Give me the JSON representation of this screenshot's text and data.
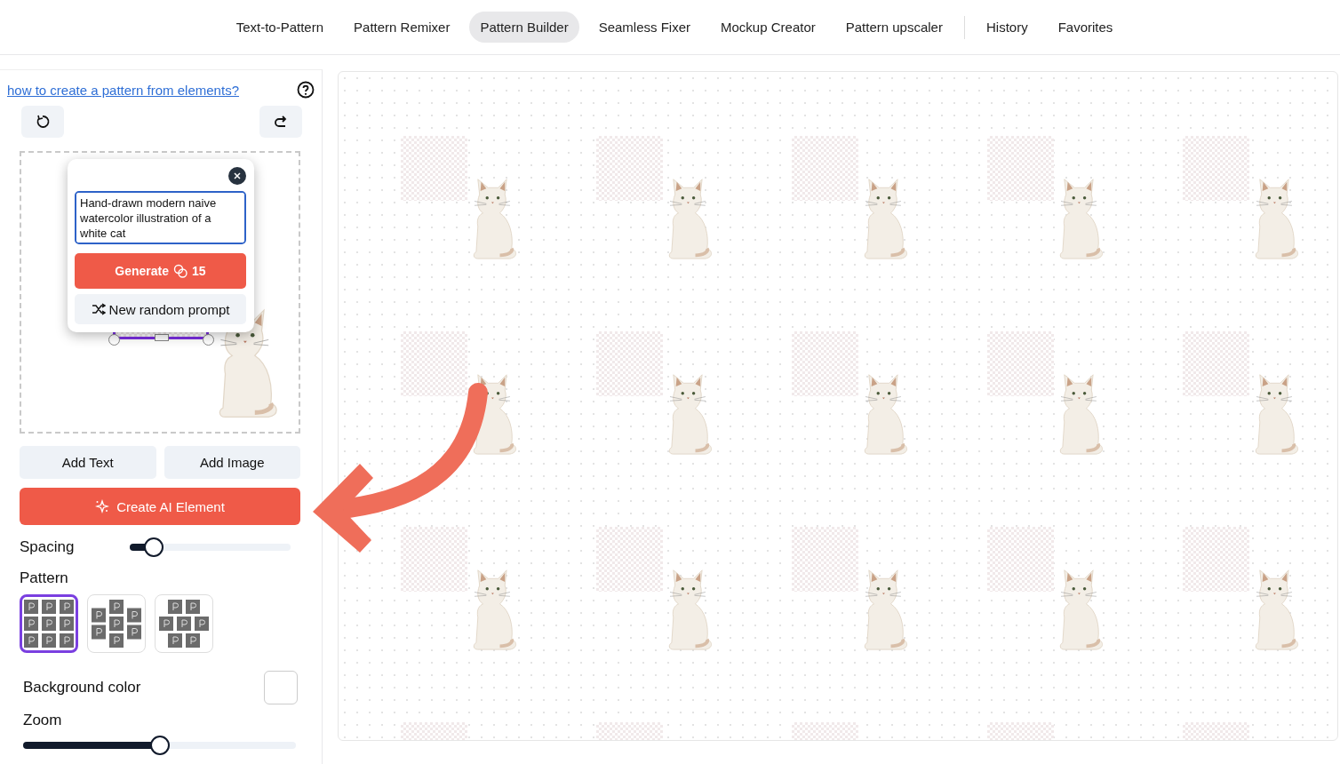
{
  "nav": {
    "tools": [
      {
        "label": "Text-to-Pattern",
        "selected": false
      },
      {
        "label": "Pattern Remixer",
        "selected": false
      },
      {
        "label": "Pattern Builder",
        "selected": true
      },
      {
        "label": "Seamless Fixer",
        "selected": false
      },
      {
        "label": "Mockup Creator",
        "selected": false
      },
      {
        "label": "Pattern upscaler",
        "selected": false
      }
    ],
    "library": [
      {
        "label": "History",
        "selected": false
      },
      {
        "label": "Favorites",
        "selected": false
      }
    ]
  },
  "sidebar": {
    "help_link": "how to create a pattern from elements?",
    "popup": {
      "prompt": "Hand-drawn modern naive watercolor illustration of a white cat",
      "generate_label": "Generate",
      "generate_cost": "15",
      "random_label": "New random prompt"
    },
    "buttons": [
      "Add Text",
      "Add Image"
    ],
    "create_ai_label": "Create AI Element",
    "spacing": {
      "label": "Spacing",
      "level": 0.15
    },
    "pattern": {
      "label": "Pattern",
      "options": [
        {
          "kind": "grid",
          "selected": true
        },
        {
          "kind": "staggered",
          "selected": false
        },
        {
          "kind": "offset",
          "selected": false
        }
      ]
    },
    "background_color": {
      "label": "Background color"
    },
    "zoom": {
      "label": "Zoom",
      "level": 0.5
    }
  }
}
